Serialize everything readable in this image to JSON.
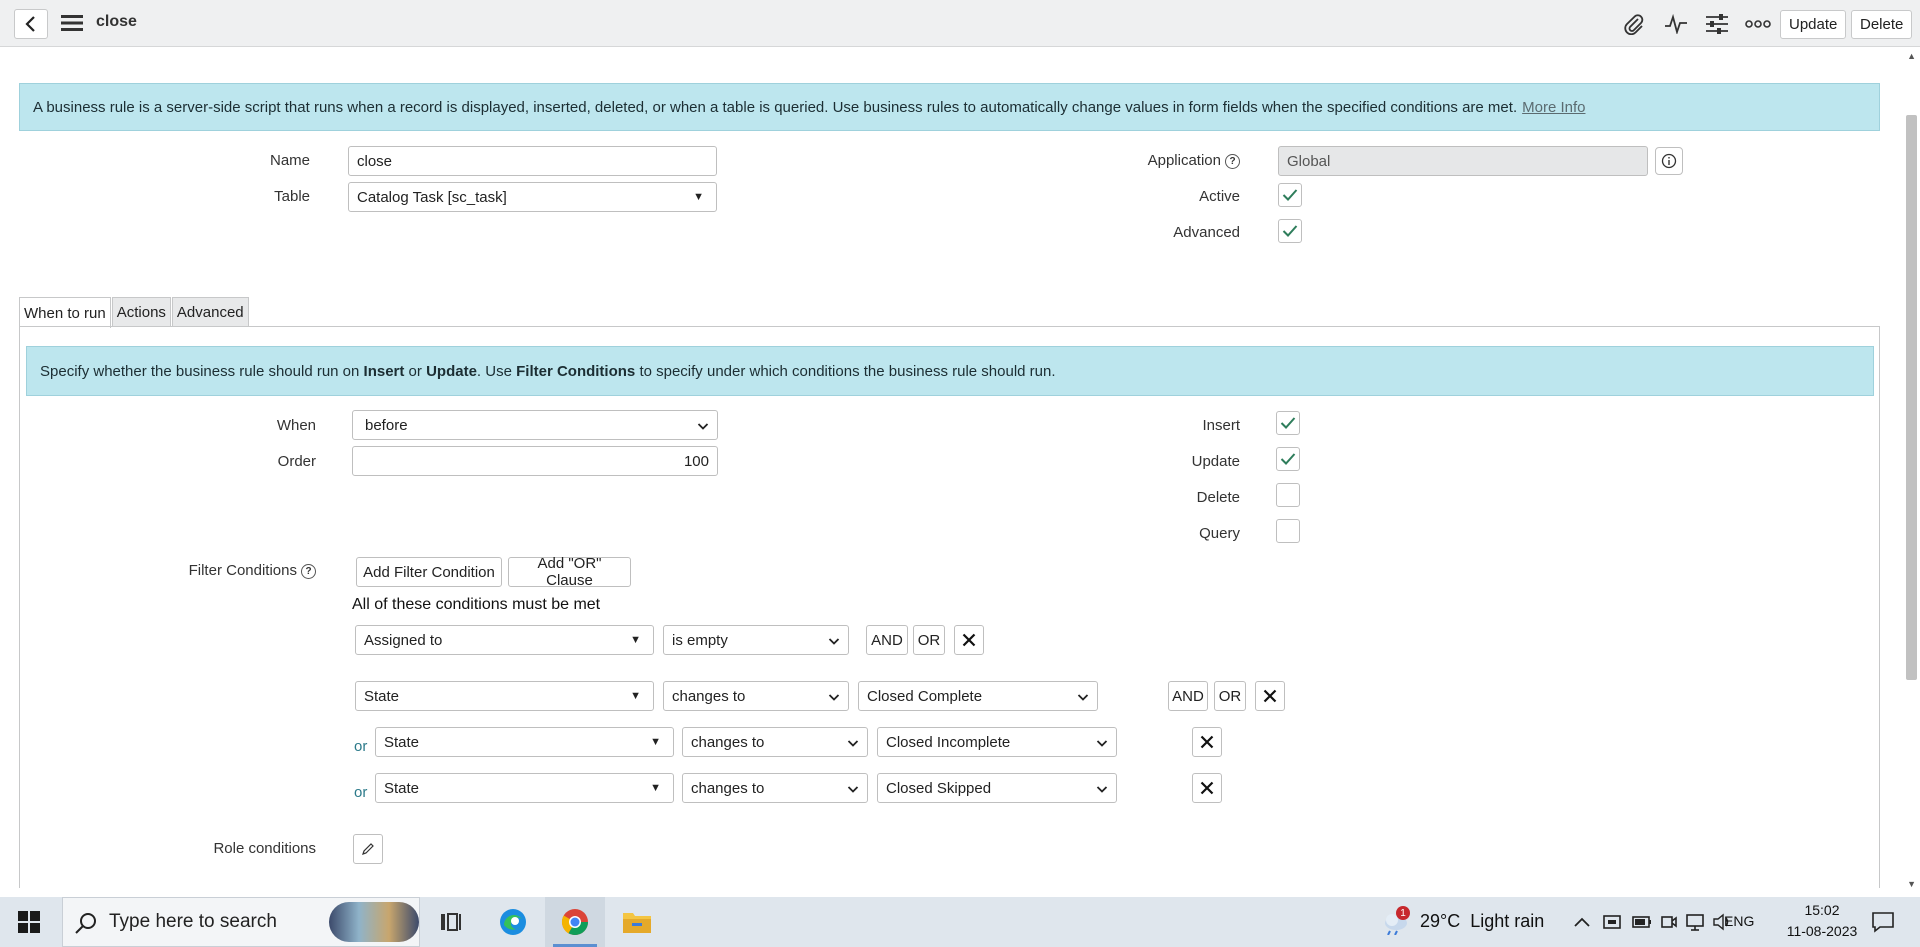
{
  "header": {
    "title": "close",
    "buttons": {
      "update": "Update",
      "delete": "Delete"
    }
  },
  "banner": {
    "text": "A business rule is a server-side script that runs when a record is displayed, inserted, deleted, or when a table is queried. Use business rules to automatically change values in form fields when the specified conditions are met.",
    "link": "More Info"
  },
  "form": {
    "name_label": "Name",
    "name_value": "close",
    "table_label": "Table",
    "table_value": "Catalog Task [sc_task]",
    "application_label": "Application",
    "application_value": "Global",
    "active_label": "Active",
    "advanced_label": "Advanced",
    "active_checked": true,
    "advanced_checked": true
  },
  "tabs": [
    "When to run",
    "Actions",
    "Advanced"
  ],
  "when_to_run": {
    "spec": {
      "p1": "Specify whether the business rule should run on ",
      "b1": "Insert",
      "p2": " or ",
      "b2": "Update",
      "p3": ". Use ",
      "b3": "Filter Conditions",
      "p4": " to specify under which conditions the business rule should run."
    },
    "when_label": "When",
    "when_value": "before",
    "order_label": "Order",
    "order_value": "100",
    "insert_label": "Insert",
    "update_label": "Update",
    "delete_label": "Delete",
    "query_label": "Query",
    "insert_checked": true,
    "update_checked": true,
    "delete_checked": false,
    "query_checked": false,
    "filter_label": "Filter Conditions",
    "add_filter": "Add Filter Condition",
    "add_or": "Add \"OR\" Clause",
    "all_conditions": "All of these conditions must be met",
    "and_label": "AND",
    "or_label": "OR",
    "or_prefix": "or",
    "conditions": [
      {
        "field": "Assigned to",
        "operator": "is empty",
        "value": ""
      },
      {
        "field": "State",
        "operator": "changes to",
        "value": "Closed Complete"
      },
      {
        "field": "State",
        "operator": "changes to",
        "value": "Closed Incomplete"
      },
      {
        "field": "State",
        "operator": "changes to",
        "value": "Closed Skipped"
      }
    ],
    "role_label": "Role conditions"
  },
  "taskbar": {
    "search_placeholder": "Type here to search",
    "weather": "29°C  Light rain",
    "weather_badge": "1",
    "lang": "ENG",
    "time": "15:02",
    "date": "11-08-2023"
  },
  "colors": {
    "banner": "#bde6ee",
    "check": "#2e7d5b",
    "link": "#2c7a8a"
  }
}
